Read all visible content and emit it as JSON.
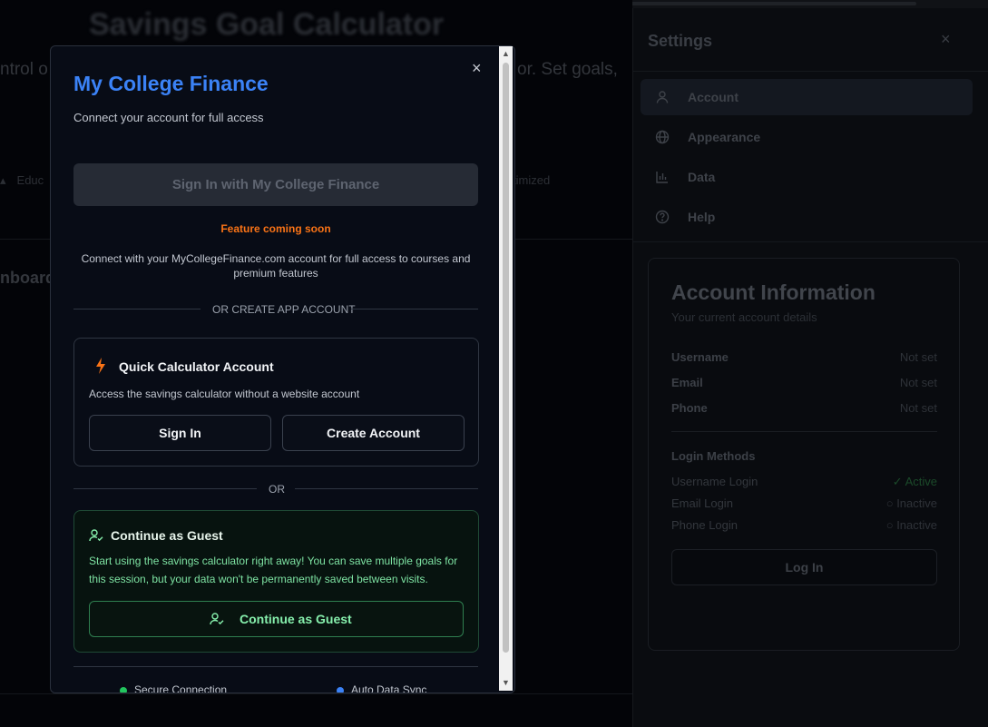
{
  "background": {
    "title": "Savings Goal Calculator",
    "intro_left": "ntrol o",
    "intro_right": "or. Set goals,",
    "edu_text": "Educ",
    "optimized_text": "timized",
    "dashboard_text": "nboard"
  },
  "settings": {
    "title": "Settings",
    "close_glyph": "×",
    "nav": [
      {
        "label": "Account",
        "icon": "user-icon",
        "active": true
      },
      {
        "label": "Appearance",
        "icon": "globe-icon"
      },
      {
        "label": "Data",
        "icon": "bar-chart-icon"
      },
      {
        "label": "Help",
        "icon": "help-circle-icon"
      }
    ],
    "account": {
      "title": "Account Information",
      "subtitle": "Your current account details",
      "fields": [
        {
          "label": "Username",
          "value": "Not set"
        },
        {
          "label": "Email",
          "value": "Not set"
        },
        {
          "label": "Phone",
          "value": "Not set"
        }
      ],
      "login_methods_title": "Login Methods",
      "login_methods": [
        {
          "label": "Username Login",
          "status": "✓ Active"
        },
        {
          "label": "Email Login",
          "status": "○ Inactive"
        },
        {
          "label": "Phone Login",
          "status": "○ Inactive"
        }
      ],
      "login_button": "Log In"
    }
  },
  "modal": {
    "close_glyph": "×",
    "title": "My College Finance",
    "subtitle": "Connect your account for full access",
    "mcf_button": "Sign In with My College Finance",
    "coming_soon": "Feature coming soon",
    "connect_text": "Connect with your MyCollegeFinance.com account for full access to courses and premium features",
    "divider_create": "OR CREATE APP ACCOUNT",
    "quick": {
      "title": "Quick Calculator Account",
      "subtitle": "Access the savings calculator without a website account",
      "sign_in": "Sign In",
      "create_account": "Create Account"
    },
    "divider_or": "OR",
    "guest": {
      "title": "Continue as Guest",
      "text": "Start using the savings calculator right away! You can save multiple goals for this session, but your data won't be permanently saved between visits.",
      "button": "Continue as Guest"
    },
    "footer": [
      {
        "label": "Secure Connection",
        "color": "#22c55e"
      },
      {
        "label": "Auto Data Sync",
        "color": "#3b82f6"
      }
    ]
  },
  "colors": {
    "accent_blue": "#3b82f6",
    "warning_orange": "#f97316",
    "success_green": "#22c55e"
  }
}
